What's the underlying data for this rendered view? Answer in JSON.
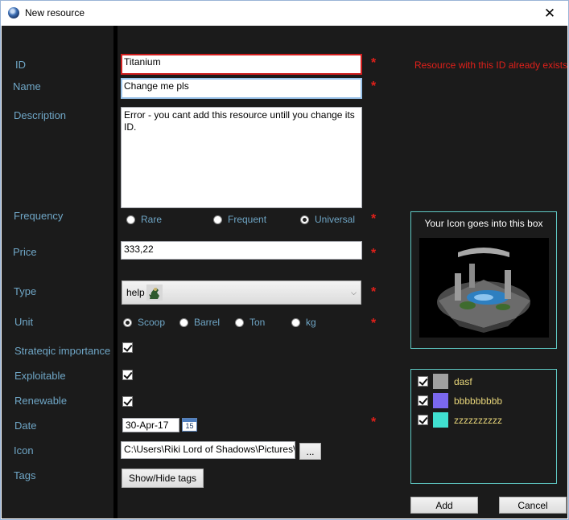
{
  "window": {
    "title": "New resource",
    "close_glyph": "✕"
  },
  "labels": {
    "id": "ID",
    "name": "Name",
    "description": "Description",
    "frequency": "Frequency",
    "price": "Price",
    "type": "Type",
    "unit": "Unit",
    "strategic": "Strateqic importance",
    "exploitable": "Exploitable",
    "renewable": "Renewable",
    "date": "Date",
    "icon": "Icon",
    "tags": "Tags"
  },
  "required_mark": "*",
  "fields": {
    "id_value": "Titanium",
    "id_error": "Resource with this ID already exists",
    "name_value": "Change me pls",
    "description_value": "Error - you cant add this resource untill you change its ID.",
    "price_value": "333,22",
    "type_value": "help",
    "date_value": "30-Apr-17",
    "calendar_day": "15",
    "icon_path": "C:\\Users\\Riki Lord of Shadows\\Pictures\\F",
    "browse_label": "..."
  },
  "frequency_options": [
    {
      "label": "Rare",
      "selected": false
    },
    {
      "label": "Frequent",
      "selected": false
    },
    {
      "label": "Universal",
      "selected": true
    }
  ],
  "unit_options": [
    {
      "label": "Scoop",
      "selected": true
    },
    {
      "label": "Barrel",
      "selected": false
    },
    {
      "label": "Ton",
      "selected": false
    },
    {
      "label": "kg",
      "selected": false
    }
  ],
  "checkboxes": {
    "strategic": true,
    "exploitable": true,
    "renewable": true
  },
  "buttons": {
    "show_hide_tags": "Show/Hide tags",
    "add": "Add",
    "cancel": "Cancel"
  },
  "icon_panel": {
    "title": "Your Icon goes into this box"
  },
  "tags": [
    {
      "name": "dasf",
      "color": "#a0a0a0",
      "checked": true
    },
    {
      "name": "bbbbbbbbb",
      "color": "#7b68ee",
      "checked": true
    },
    {
      "name": "zzzzzzzzzz",
      "color": "#40e0d0",
      "checked": true
    }
  ],
  "colors": {
    "accent_label": "#6fa6c6",
    "error": "#e0201a",
    "panel_border": "#5fc9c4",
    "tag_text": "#e8d67a",
    "background": "#1b1b1b"
  }
}
